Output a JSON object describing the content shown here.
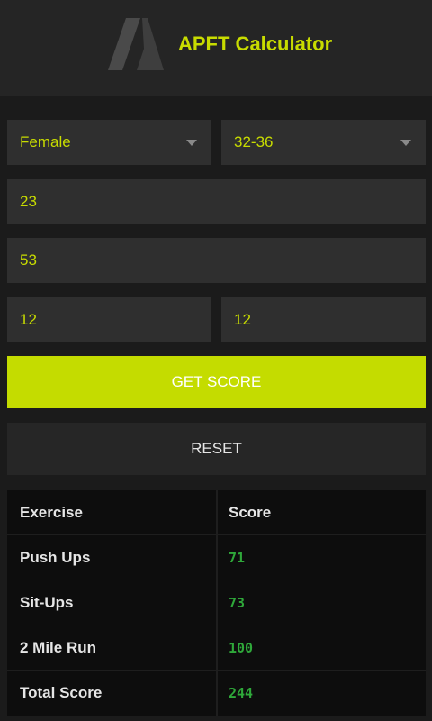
{
  "header": {
    "title": "APFT Calculator",
    "logo_icon": "a-logo-icon"
  },
  "form": {
    "gender": {
      "value": "Female",
      "options": [
        "Female"
      ]
    },
    "age_group": {
      "value": "32-36",
      "options": [
        "32-36"
      ]
    },
    "push_ups": {
      "value": "23"
    },
    "sit_ups": {
      "value": "53"
    },
    "run_minutes": {
      "value": "12"
    },
    "run_seconds": {
      "value": "12"
    }
  },
  "buttons": {
    "get_score": "GET SCORE",
    "reset": "RESET"
  },
  "results": {
    "headers": [
      "Exercise",
      "Score"
    ],
    "rows": [
      {
        "exercise": "Push Ups",
        "score": "71"
      },
      {
        "exercise": "Sit-Ups",
        "score": "73"
      },
      {
        "exercise": "2 Mile Run",
        "score": "100"
      },
      {
        "exercise": "Total Score",
        "score": "244"
      }
    ]
  },
  "colors": {
    "accent": "#c4dc00",
    "score_green": "#2fa83a",
    "background": "#1b1b1b",
    "field": "#2f2f2f"
  }
}
